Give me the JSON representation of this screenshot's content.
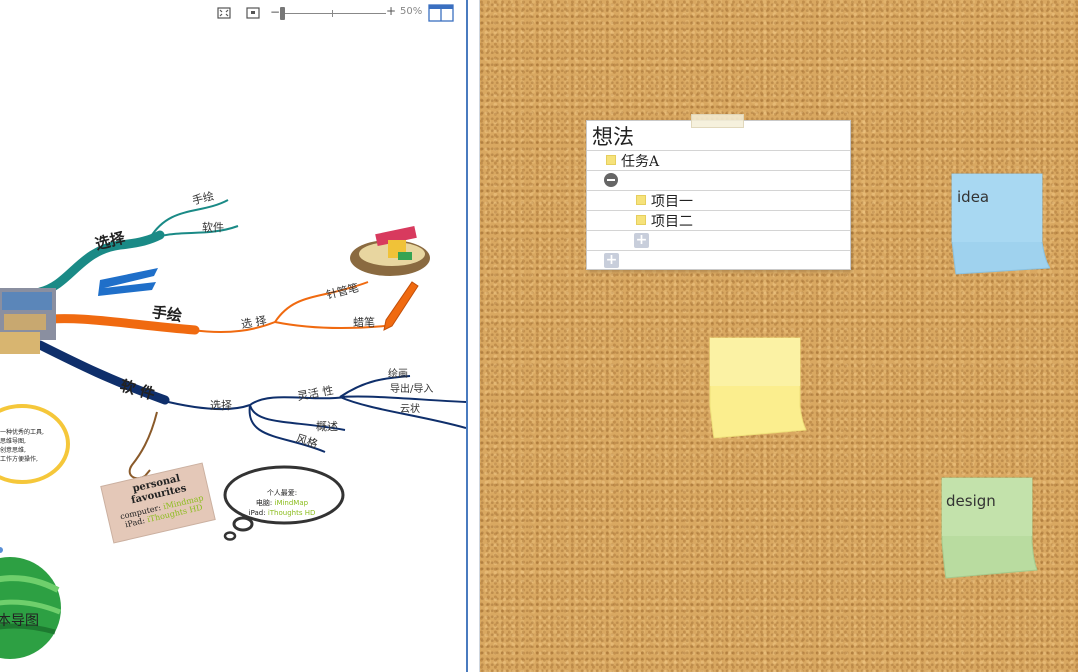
{
  "toolbar": {
    "fit_icon": "fit-screen-icon",
    "frame_icon": "frame-icon",
    "zoom_out_label": "−",
    "zoom_in_label": "+",
    "zoom_percent": "50%",
    "zoom_level": 0.1,
    "layout_icon": "split-layout-icon"
  },
  "mindmap": {
    "branches": [
      {
        "label": "选择",
        "color": "#1a8a86",
        "children": [
          "手绘",
          "软件"
        ]
      },
      {
        "label": "手绘",
        "color": "#f06a10",
        "sub_label": "选 择",
        "children": [
          "针管笔",
          "蜡笔"
        ]
      },
      {
        "label": "软 件",
        "color": "#0f2f6b",
        "sub_label": "选择",
        "sub_children": [
          {
            "label": "灵活 性",
            "children": [
              "绘画",
              "导出/导入",
              "云状"
            ]
          },
          {
            "label": "概述"
          },
          {
            "label": "风格"
          }
        ]
      }
    ],
    "callout_yellow": [
      "一种优秀的工具,",
      "思维导图,",
      "创意思维,",
      "工作方便操作,"
    ],
    "tag_card": {
      "title": "personal favourites",
      "line1_label": "computer:",
      "line1_value": "iMindmap",
      "line2_label": "iPad:",
      "line2_value": "iThoughts HD"
    },
    "thought_bubble": {
      "title": "个人最爱:",
      "line1_label": "电脑:",
      "line1_value": "iMindMap",
      "line2_label": "iPad:",
      "line2_value": "iThoughts HD"
    },
    "center_globe_label": "本导图",
    "colors": {
      "teal": "#1a8a86",
      "orange": "#f06a10",
      "navy": "#0f2f6b",
      "yellow": "#f5c73a",
      "lime": "#8cbd1e"
    }
  },
  "board": {
    "checklist": {
      "title": "想法",
      "items": [
        {
          "text": "任务A",
          "level": 0
        },
        {
          "text": "",
          "level": 0,
          "collapse": true
        },
        {
          "text": "项目一",
          "level": 1
        },
        {
          "text": "项目二",
          "level": 1
        }
      ],
      "add_sub_label": "+",
      "add_label": "+"
    },
    "stickies": [
      {
        "text": "idea",
        "color": "#9fd2ee"
      },
      {
        "text": "",
        "color": "#fbee8e"
      },
      {
        "text": "design",
        "color": "#b9dca0"
      }
    ]
  }
}
